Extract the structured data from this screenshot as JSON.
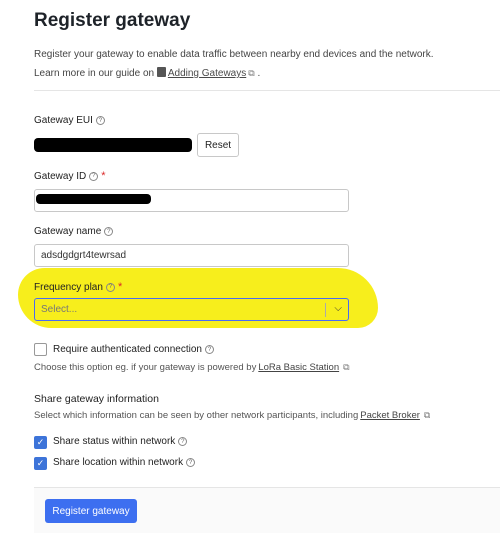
{
  "page": {
    "title": "Register gateway",
    "description_line1": "Register your gateway to enable data traffic between nearby end devices and the network.",
    "description_prefix": "Learn more in our guide on",
    "guide_link": "Adding Gateways",
    "description_suffix": "."
  },
  "fields": {
    "gateway_eui": {
      "label": "Gateway EUI",
      "value": ""
    },
    "reset_button": "Reset",
    "gateway_id": {
      "label": "Gateway ID",
      "value": ""
    },
    "gateway_name": {
      "label": "Gateway name",
      "value": "adsdgdgrt4tewrsad"
    },
    "frequency_plan": {
      "label": "Frequency plan",
      "placeholder": "Select..."
    }
  },
  "auth": {
    "checkbox_label": "Require authenticated connection",
    "checked": false,
    "hint_prefix": "Choose this option eg. if your gateway is powered by",
    "hint_link": "LoRa Basic Station"
  },
  "share": {
    "title": "Share gateway information",
    "hint_prefix": "Select which information can be seen by other network participants, including",
    "hint_link": "Packet Broker",
    "status_label": "Share status within network",
    "status_checked": true,
    "location_label": "Share location within network",
    "location_checked": true
  },
  "submit_button": "Register gateway",
  "colors": {
    "primary": "#3d6ff0",
    "checkbox": "#3d74d9",
    "highlight": "#f7ee1c",
    "required": "#db2828"
  }
}
